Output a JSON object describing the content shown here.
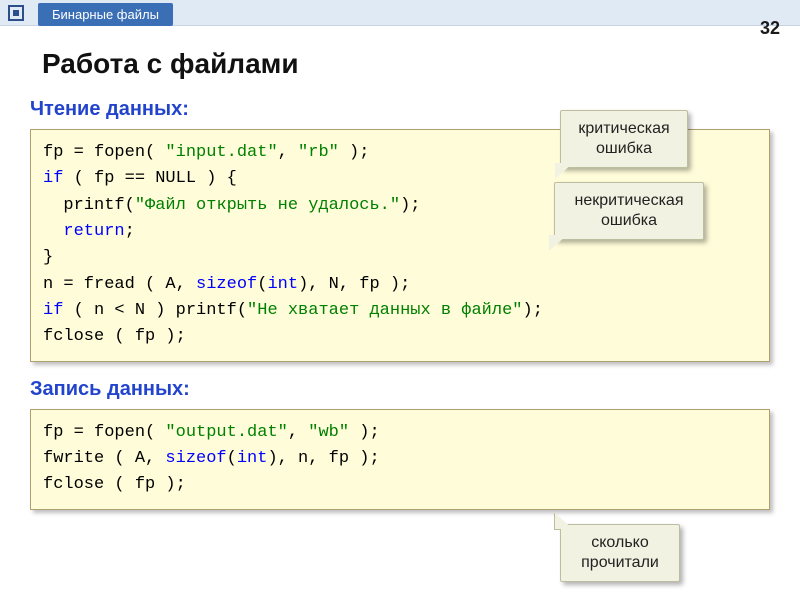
{
  "header": {
    "tab": "Бинарные файлы",
    "page_number": "32"
  },
  "title": "Работа с файлами",
  "sections": {
    "read": "Чтение данных:",
    "write": "Запись данных:"
  },
  "code": {
    "read": {
      "l1a": "fp = fopen( ",
      "l1s": "\"input.dat\"",
      "l1b": ", ",
      "l1s2": "\"rb\"",
      "l1c": " );",
      "l2a": "if",
      "l2b": " ( fp == NULL ) {",
      "l3a": "  printf(",
      "l3s": "\"Файл открыть не удалось.\"",
      "l3b": ");",
      "l4a": "  return",
      "l4b": ";",
      "l5": "}",
      "l6a": "n = fread ( A, ",
      "l6k": "sizeof",
      "l6b": "(",
      "l6k2": "int",
      "l6c": "), N, fp );",
      "l7a": "if",
      "l7b": " ( n < N ) printf(",
      "l7s": "\"Не хватает данных в файле\"",
      "l7c": ");",
      "l8": "fclose ( fp );"
    },
    "write": {
      "l1a": "fp = fopen( ",
      "l1s": "\"output.dat\"",
      "l1b": ", ",
      "l1s2": "\"wb\"",
      "l1c": " );",
      "l2a": "fwrite ( A, ",
      "l2k": "sizeof",
      "l2b": "(",
      "l2k2": "int",
      "l2c": "), n, fp );",
      "l3": "fclose ( fp );"
    }
  },
  "callouts": {
    "c1_l1": "критическая",
    "c1_l2": "ошибка",
    "c2_l1": "некритическая",
    "c2_l2": "ошибка",
    "c3_l1": "сколько",
    "c3_l2": "прочитали"
  }
}
